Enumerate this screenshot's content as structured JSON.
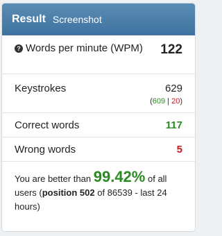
{
  "header": {
    "title": "Result",
    "subtitle": "Screenshot"
  },
  "stats": {
    "wpm": {
      "icon": "question-circle-icon",
      "label": "Words per minute (WPM)",
      "value": "122"
    },
    "keystrokes": {
      "label": "Keystrokes",
      "value": "629",
      "correct": "609",
      "separator": "|",
      "wrong": "20"
    },
    "correct_words": {
      "label": "Correct words",
      "value": "117"
    },
    "wrong_words": {
      "label": "Wrong words",
      "value": "5"
    }
  },
  "summary": {
    "prefix": "You are better than",
    "percent": "99.42%",
    "middle": "of all users (",
    "position_label": "position 502",
    "suffix": "of 86539 - last 24 hours)"
  },
  "colors": {
    "header": "#4a7ca8",
    "good": "#2a8a22",
    "bad": "#c8171f"
  }
}
